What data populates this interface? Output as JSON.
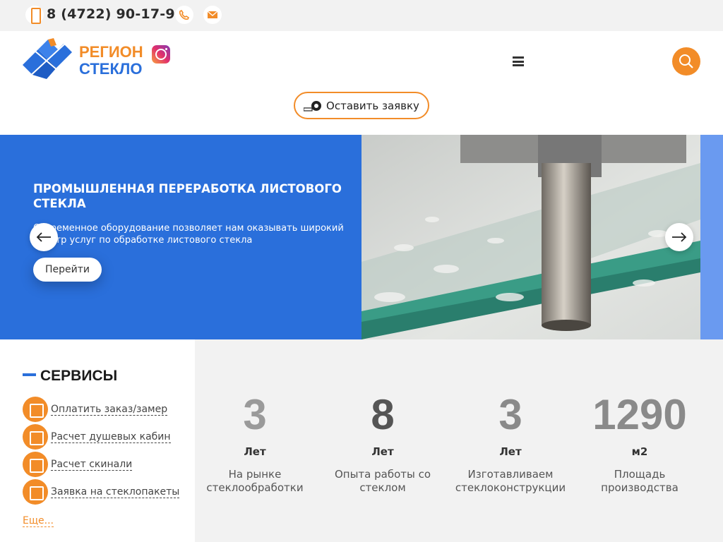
{
  "topbar": {
    "phone": "8 (4722) 90-17-96"
  },
  "header": {
    "logo_line1": "РЕГИОН",
    "logo_line2": "СТЕКЛО",
    "order_button": "Оставить заявку"
  },
  "slider": {
    "title": "ПРОМЫШЛЕННАЯ ПЕРЕРАБОТКА ЛИСТОВОГО СТЕКЛА",
    "text": "Современное оборудование позволяет нам оказывать широкий спектр услуг по обработке листового стекла",
    "button": "Перейти"
  },
  "services": {
    "title": "СЕРВИСЫ",
    "items": [
      "Оплатить заказ/замер",
      "Расчет душевых кабин",
      "Расчет скинали",
      "Заявка на стеклопакеты"
    ],
    "more": "Еще..."
  },
  "stats": [
    {
      "value": "3",
      "unit": "Лет",
      "desc": "На рынке стеклообработки",
      "color": "#9a9a9a"
    },
    {
      "value": "8",
      "unit": "Лет",
      "desc": "Опыта работы со стеклом",
      "color": "#555555"
    },
    {
      "value": "3",
      "unit": "Лет",
      "desc": "Изготавливаем стеклоконструкции",
      "color": "#8a8a8a"
    },
    {
      "value": "1290",
      "unit": "м2",
      "desc": "Площадь производства",
      "color": "#8a8a8a"
    }
  ],
  "colors": {
    "accent": "#f28c28",
    "brand_blue": "#2a6fdb"
  }
}
